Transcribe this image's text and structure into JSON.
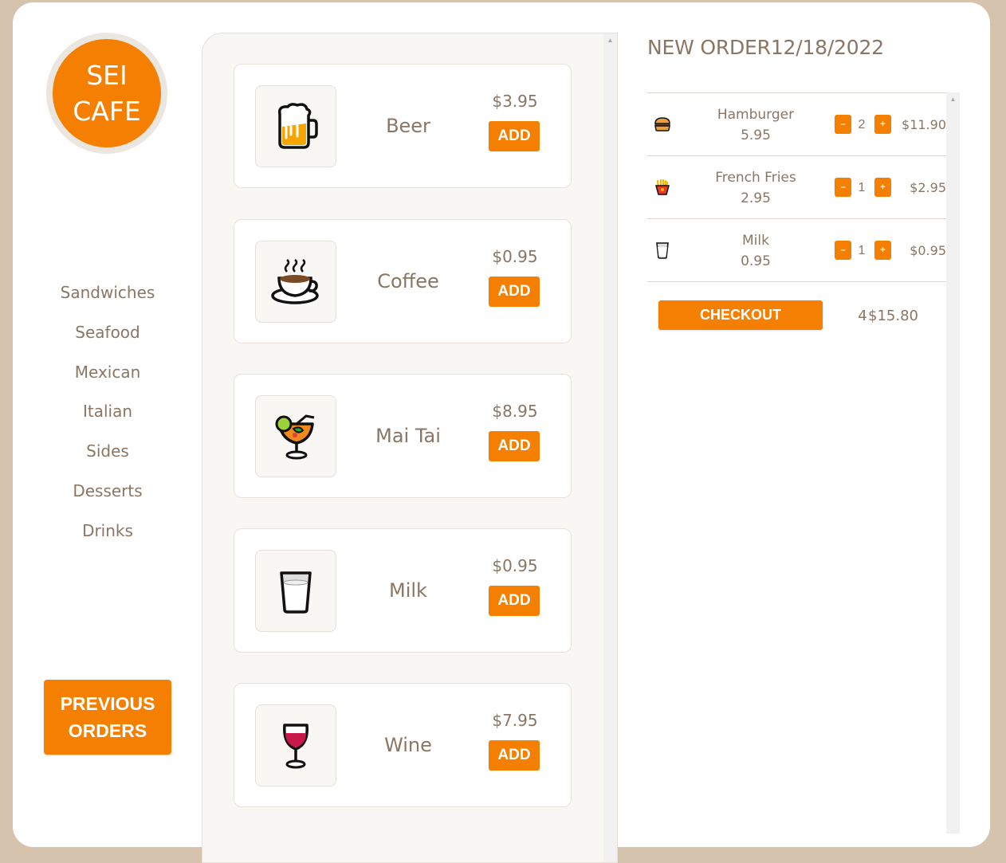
{
  "brand": {
    "line1": "SEI",
    "line2": "CAFE",
    "color": "#f57f00"
  },
  "categories": [
    "Sandwiches",
    "Seafood",
    "Mexican",
    "Italian",
    "Sides",
    "Desserts",
    "Drinks"
  ],
  "previous_orders": {
    "line1": "PREVIOUS",
    "line2": "ORDERS"
  },
  "menu": {
    "add_label": "ADD",
    "items": [
      {
        "name": "Beer",
        "price": "$3.95",
        "icon": "beer-mug-icon"
      },
      {
        "name": "Coffee",
        "price": "$0.95",
        "icon": "coffee-cup-icon"
      },
      {
        "name": "Mai Tai",
        "price": "$8.95",
        "icon": "tropical-drink-icon"
      },
      {
        "name": "Milk",
        "price": "$0.95",
        "icon": "milk-glass-icon"
      },
      {
        "name": "Wine",
        "price": "$7.95",
        "icon": "wine-glass-icon"
      }
    ]
  },
  "order": {
    "title": "NEW ORDER12/18/2022",
    "items": [
      {
        "name": "Hamburger",
        "unit_price": "5.95",
        "qty": "2",
        "total": "$11.90",
        "icon": "hamburger-icon"
      },
      {
        "name": "French Fries",
        "unit_price": "2.95",
        "qty": "1",
        "total": "$2.95",
        "icon": "french-fries-icon"
      },
      {
        "name": "Milk",
        "unit_price": "0.95",
        "qty": "1",
        "total": "$0.95",
        "icon": "milk-glass-icon"
      }
    ],
    "minus_label": "–",
    "plus_label": "+",
    "checkout_label": "CHECKOUT",
    "total_count": "4",
    "total_amount": "$15.80"
  }
}
